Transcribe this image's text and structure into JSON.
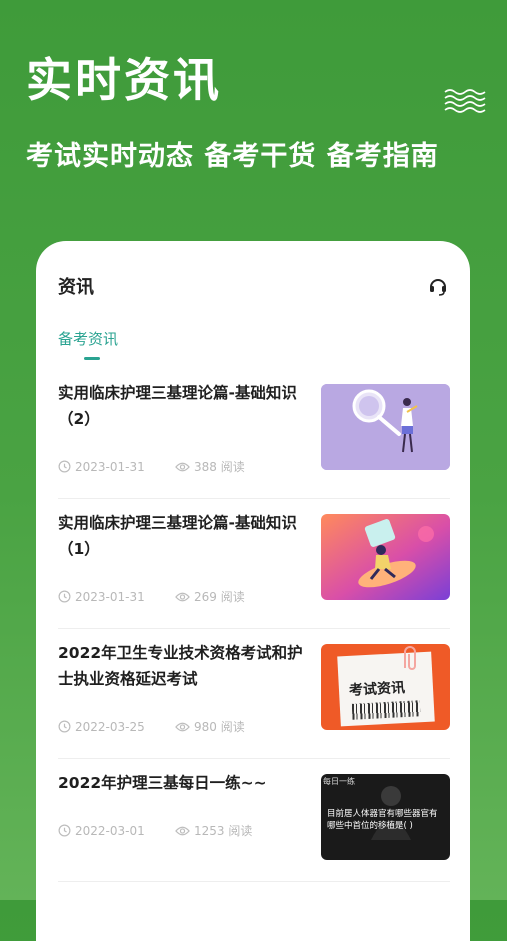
{
  "hero": {
    "title": "实时资讯",
    "subtitle": "考试实时动态  备考干货  备考指南"
  },
  "card": {
    "header": "资讯",
    "tab": "备考资讯"
  },
  "articles": [
    {
      "title": "实用临床护理三基理论篇-基础知识（2）",
      "date": "2023-01-31",
      "views": "388 阅读"
    },
    {
      "title": "实用临床护理三基理论篇-基础知识（1）",
      "date": "2023-01-31",
      "views": "269 阅读"
    },
    {
      "title": "2022年卫生专业技术资格考试和护士执业资格延迟考试",
      "date": "2022-03-25",
      "views": "980 阅读"
    },
    {
      "title": "2022年护理三基每日一练~~",
      "date": "2022-03-01",
      "views": "1253 阅读"
    }
  ],
  "thumbnails": {
    "third_label": "考试资讯",
    "fourth_caption": "目前居人体器官有哪些器官有哪些中首位的移植是(    )",
    "fourth_tag": "每日一练"
  },
  "colors": {
    "primary_green": "#3f9b3a",
    "accent_teal": "#2aa391"
  }
}
